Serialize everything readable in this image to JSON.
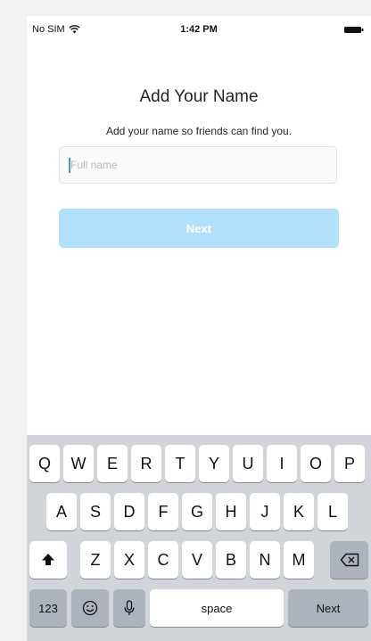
{
  "status_bar": {
    "carrier": "No SIM",
    "time": "1:42 PM"
  },
  "screen": {
    "title": "Add Your Name",
    "subtitle": "Add your name so friends can find you.",
    "name_field": {
      "placeholder": "Full name",
      "value": ""
    },
    "next_button_label": "Next"
  },
  "keyboard": {
    "row1": [
      "Q",
      "W",
      "E",
      "R",
      "T",
      "Y",
      "U",
      "I",
      "O",
      "P"
    ],
    "row2": [
      "A",
      "S",
      "D",
      "F",
      "G",
      "H",
      "J",
      "K",
      "L"
    ],
    "row3": [
      "Z",
      "X",
      "C",
      "V",
      "B",
      "N",
      "M"
    ],
    "numbers_label": "123",
    "space_label": "space",
    "return_label": "Next"
  },
  "icons": {
    "wifi": "wifi-icon",
    "battery": "battery-icon",
    "shift": "shift-icon",
    "backspace": "backspace-icon",
    "emoji": "emoji-icon",
    "mic": "microphone-icon"
  },
  "colors": {
    "next_button": "#b2dffc",
    "cursor": "#3897f0",
    "keyboard_bg": "#d1d4d9"
  }
}
